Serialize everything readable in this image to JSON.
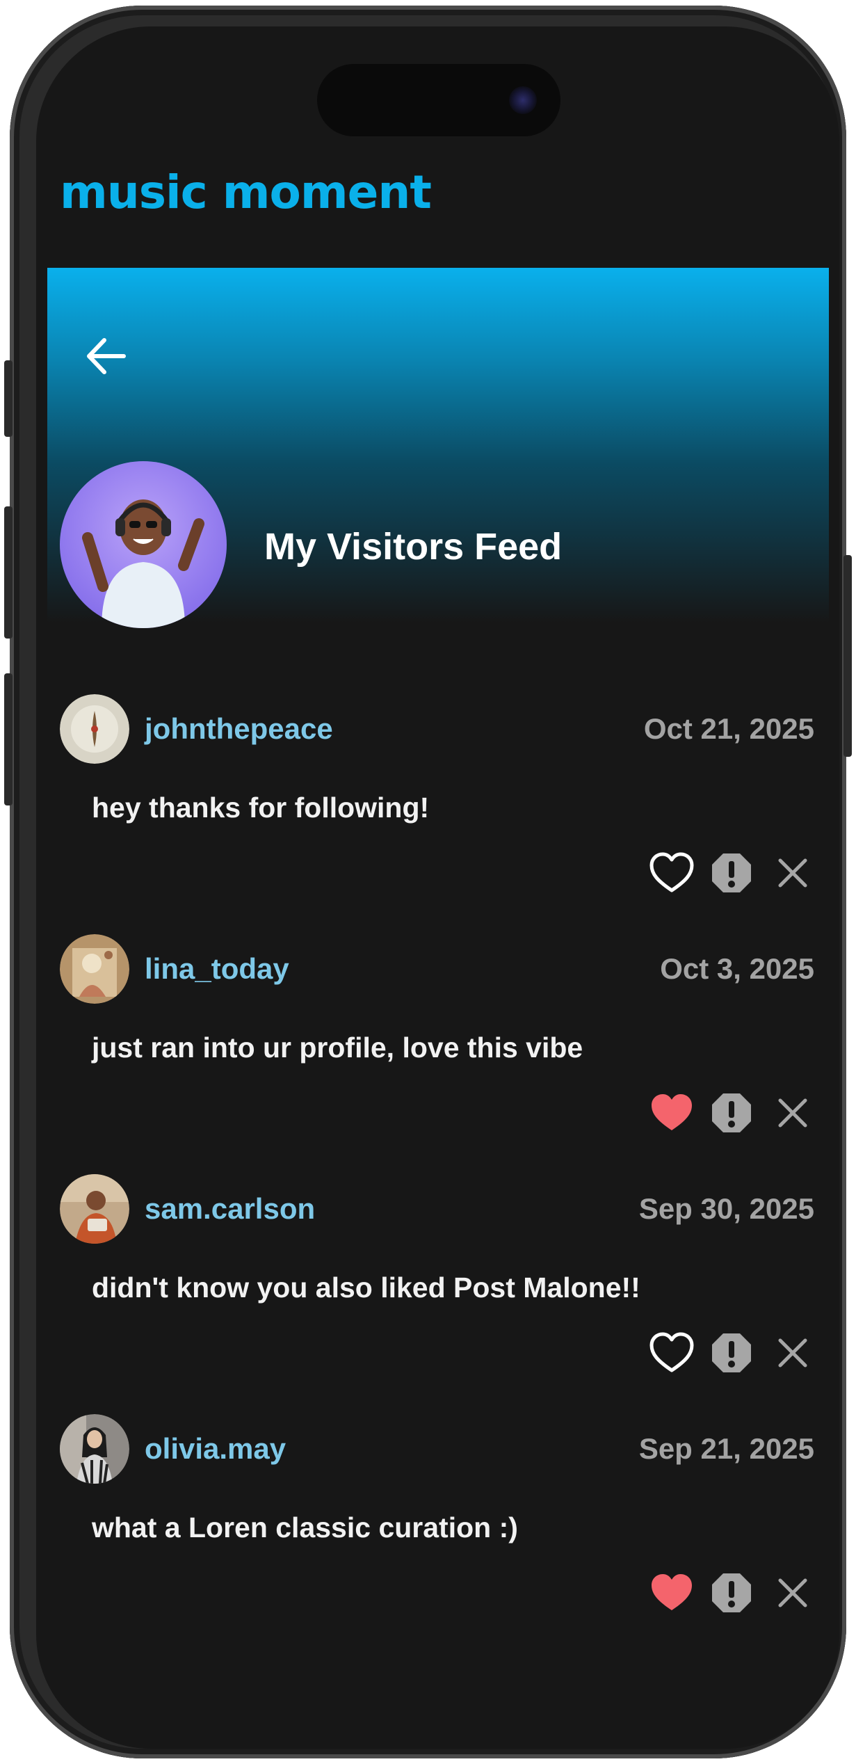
{
  "app": {
    "logo_text": "music moment",
    "brand_color": "#0ab0ea"
  },
  "header": {
    "back_icon": "arrow-left-icon",
    "title": "My Visitors Feed",
    "avatar_icon": "profile-avatar"
  },
  "posts": [
    {
      "username": "johnthepeace",
      "date": "Oct 21, 2025",
      "message": "hey thanks for following!",
      "liked": false
    },
    {
      "username": "lina_today",
      "date": "Oct 3, 2025",
      "message": "just ran into ur profile, love this vibe",
      "liked": true
    },
    {
      "username": "sam.carlson",
      "date": "Sep 30, 2025",
      "message": "didn't know you also liked Post Malone!!",
      "liked": false
    },
    {
      "username": "olivia.may",
      "date": "Sep 21, 2025",
      "message": "what a Loren classic curation :)",
      "liked": true
    }
  ],
  "colors": {
    "username": "#7ec8e8",
    "date": "#a3a3a3",
    "liked_heart": "#f4646c",
    "icon_gray": "#a6a6a6"
  }
}
